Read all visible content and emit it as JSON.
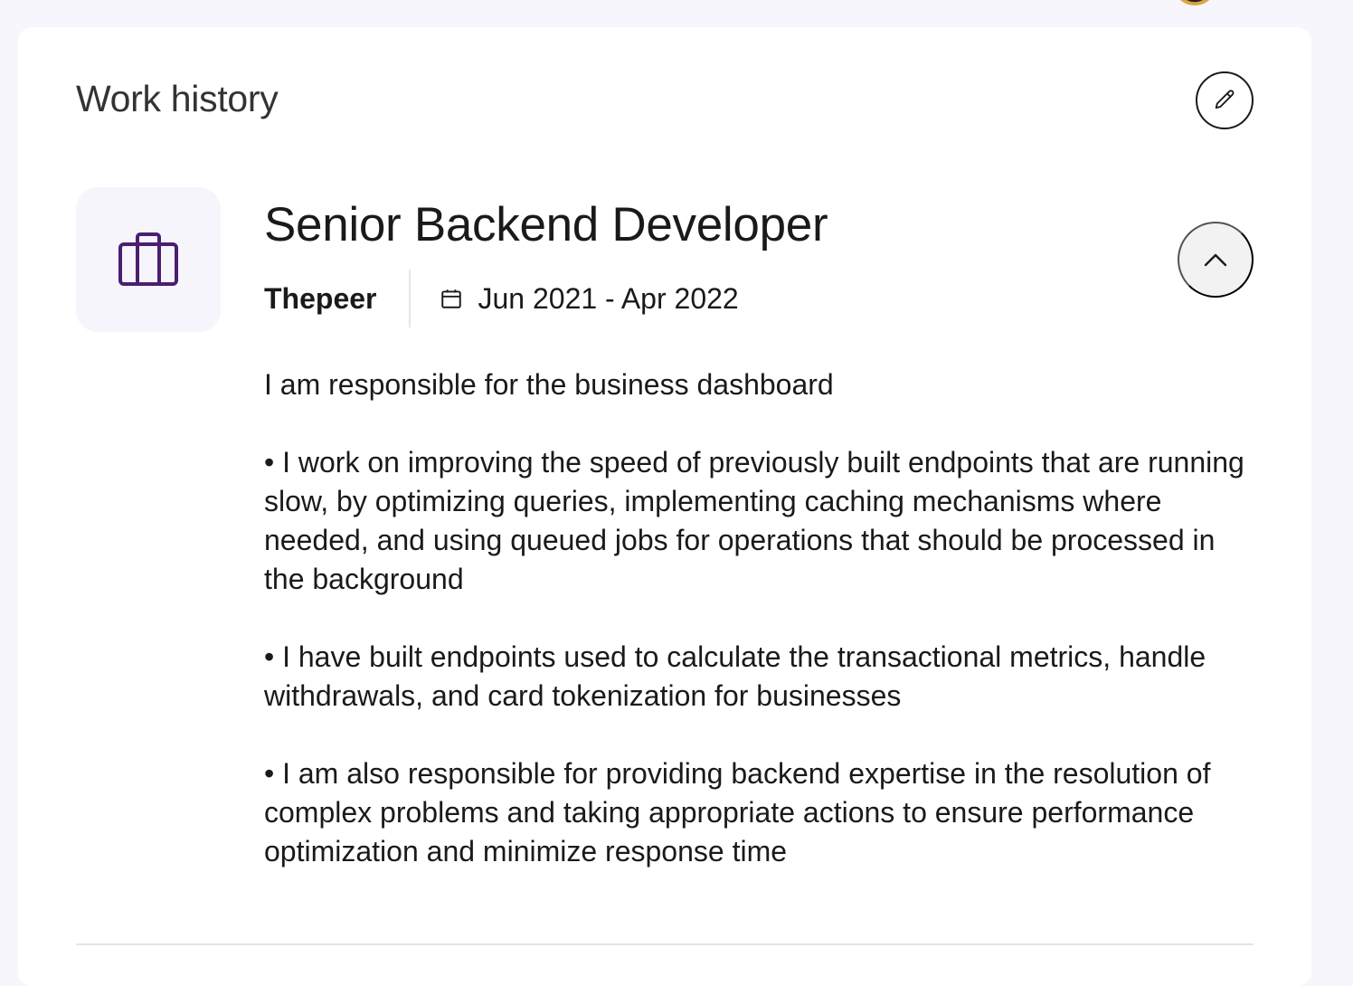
{
  "section": {
    "title": "Work history",
    "edit_icon": "pencil-icon",
    "accent_color": "#4b1f6f"
  },
  "job": {
    "icon": "briefcase-icon",
    "title": "Senior Backend Developer",
    "company": "Thepeer",
    "date_icon": "calendar-icon",
    "dates": "Jun 2021 - Apr 2022",
    "collapse_icon": "chevron-up-icon",
    "description": "I am responsible for the business dashboard\n\n• I work on improving the speed of previously built endpoints that are running slow, by optimizing queries, implementing caching mechanisms where needed, and using queued jobs for operations that should be processed in the background\n\n• I have built endpoints used to calculate the transactional metrics, handle withdrawals, and card tokenization for businesses\n\n• I am also responsible for providing backend expertise in the resolution of complex problems and taking appropriate actions to ensure performance optimization and minimize response time"
  }
}
